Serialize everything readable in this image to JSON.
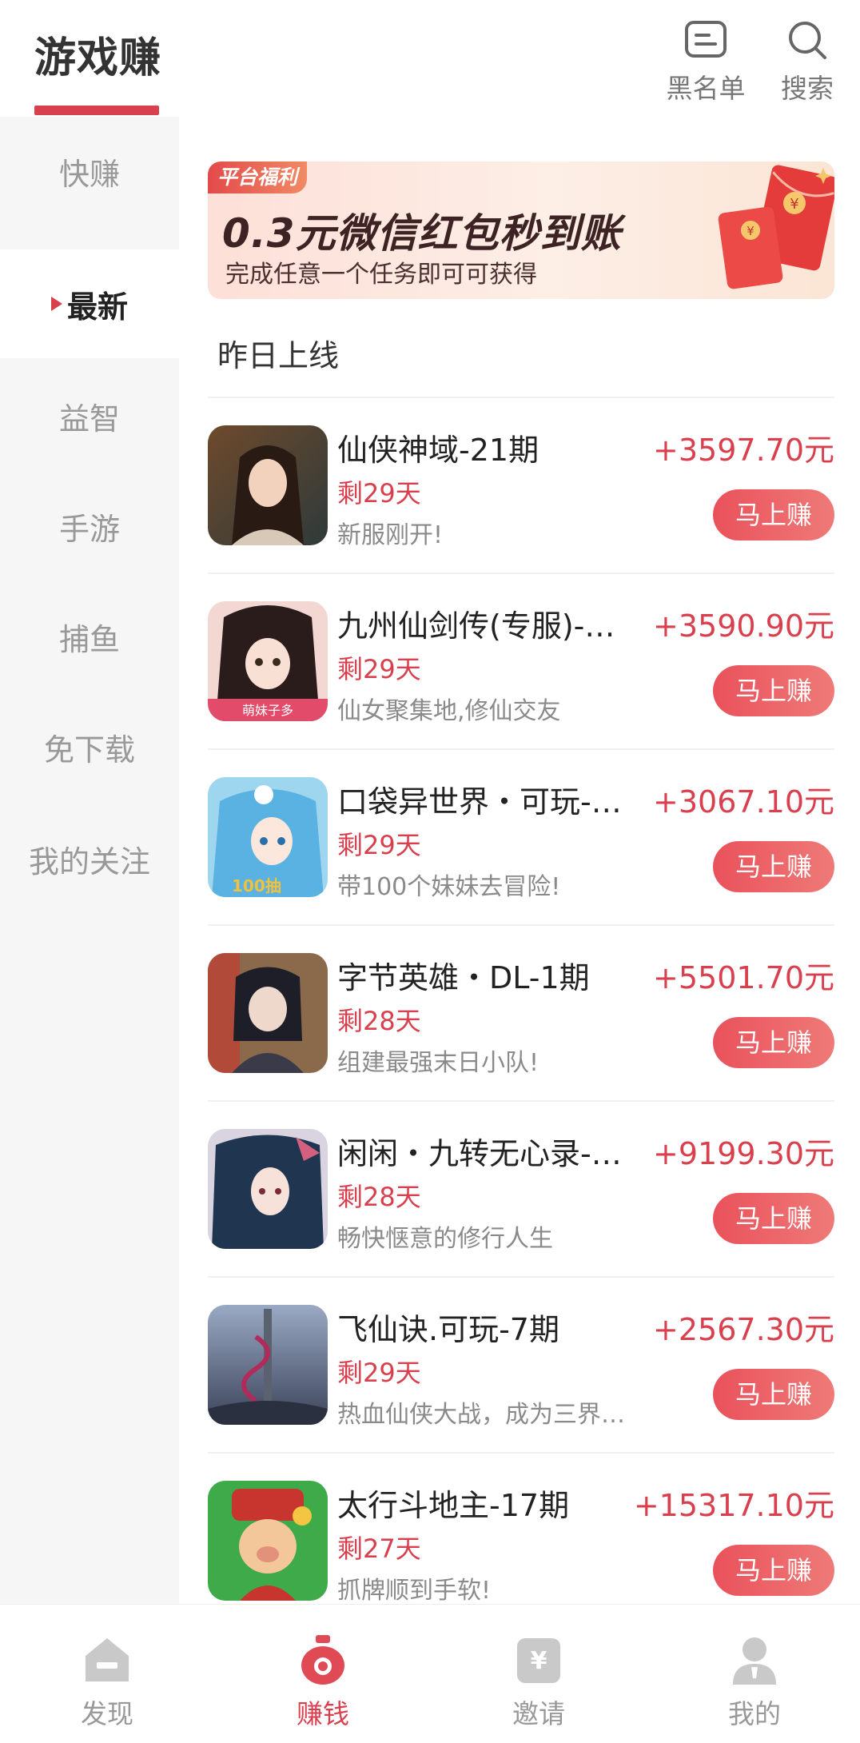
{
  "header": {
    "title": "游戏赚",
    "blacklist_label": "黑名单",
    "search_label": "搜索"
  },
  "sidebar": {
    "items": [
      {
        "label": "快赚"
      },
      {
        "label": "最新"
      },
      {
        "label": "益智"
      },
      {
        "label": "手游"
      },
      {
        "label": "捕鱼"
      },
      {
        "label": "免下载"
      },
      {
        "label": "我的关注"
      }
    ],
    "active_index": 1
  },
  "banner": {
    "tag": "平台福利",
    "headline": "0.3元微信红包秒到账",
    "subtext": "完成任意一个任务即可可获得"
  },
  "section_title": "昨日上线",
  "games": [
    {
      "name": "仙侠神域-21期",
      "days_left": "剩29天",
      "desc": "新服刚开!",
      "reward": "+3597.70元",
      "button": "马上赚"
    },
    {
      "name": "九州仙剑传(专服)-…",
      "days_left": "剩29天",
      "desc": "仙女聚集地,修仙交友",
      "reward": "+3590.90元",
      "button": "马上赚",
      "thumb_badge": "萌妹子多"
    },
    {
      "name": "口袋异世界・可玩-…",
      "days_left": "剩29天",
      "desc": "带100个妹妹去冒险!",
      "reward": "+3067.10元",
      "button": "马上赚",
      "thumb_badge": "100抽"
    },
    {
      "name": "字节英雄・DL-1期",
      "days_left": "剩28天",
      "desc": "组建最强末日小队!",
      "reward": "+5501.70元",
      "button": "马上赚"
    },
    {
      "name": "闲闲・九转无心录-…",
      "days_left": "剩28天",
      "desc": "畅快惬意的修行人生",
      "reward": "+9199.30元",
      "button": "马上赚"
    },
    {
      "name": "飞仙诀.可玩-7期",
      "days_left": "剩29天",
      "desc": "热血仙侠大战，成为三界…",
      "reward": "+2567.30元",
      "button": "马上赚"
    },
    {
      "name": "太行斗地主-17期",
      "days_left": "剩27天",
      "desc": "抓牌顺到手软!",
      "reward": "+15317.10元",
      "button": "马上赚"
    }
  ],
  "tabbar": {
    "tabs": [
      {
        "label": "发现",
        "icon": "home-icon"
      },
      {
        "label": "赚钱",
        "icon": "money-bag-icon"
      },
      {
        "label": "邀请",
        "icon": "yuan-icon"
      },
      {
        "label": "我的",
        "icon": "person-icon"
      }
    ],
    "active_index": 1
  },
  "colors": {
    "accent": "#d9404e",
    "sidebar_bg": "#f6f6f6",
    "muted_text": "#999999"
  }
}
